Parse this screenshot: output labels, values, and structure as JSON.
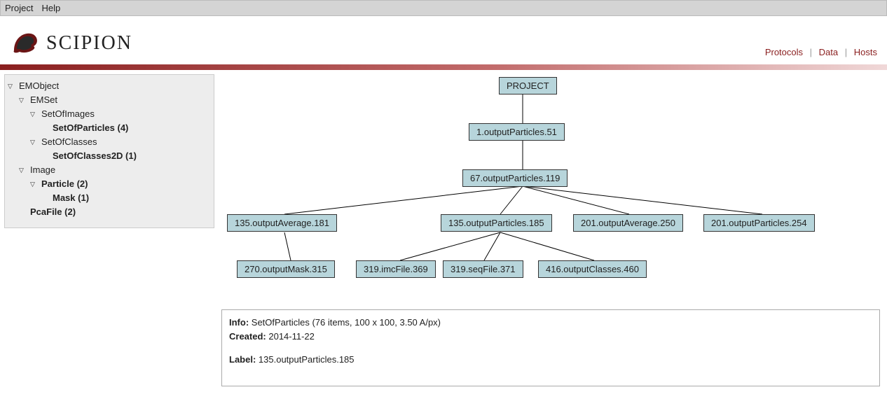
{
  "menu": {
    "project": "Project",
    "help": "Help"
  },
  "brand": {
    "name": "SCIPION"
  },
  "nav": {
    "protocols": "Protocols",
    "data": "Data",
    "hosts": "Hosts"
  },
  "tree": {
    "n0": "EMObject",
    "n1": "EMSet",
    "n2": "SetOfImages",
    "n3": "SetOfParticles (4)",
    "n4": "SetOfClasses",
    "n5": "SetOfClasses2D (1)",
    "n6": "Image",
    "n7": "Particle (2)",
    "n8": "Mask (1)",
    "n9": "PcaFile (2)"
  },
  "graph": {
    "root": "PROJECT",
    "a": "1.outputParticles.51",
    "b": "67.outputParticles.119",
    "c1": "135.outputAverage.181",
    "c2": "135.outputParticles.185",
    "c3": "201.outputAverage.250",
    "c4": "201.outputParticles.254",
    "d1": "270.outputMask.315",
    "d2": "319.imcFile.369",
    "d3": "319.seqFile.371",
    "d4": "416.outputClasses.460"
  },
  "info": {
    "line1_label": "Info:",
    "line1_val": " SetOfParticles (76 items, 100 x 100, 3.50 A/px)",
    "line2_label": "Created:",
    "line2_val": " 2014-11-22",
    "line3_label": "Label:",
    "line3_val": " 135.outputParticles.185"
  }
}
